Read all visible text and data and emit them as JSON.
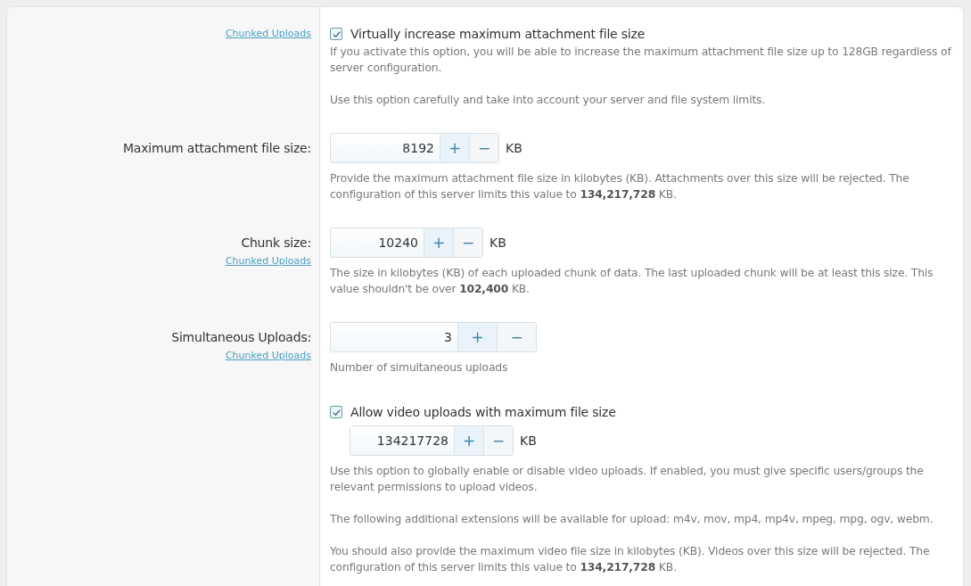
{
  "rows": [
    {
      "link": "Chunked Uploads",
      "checkbox": {
        "label": "Virtually increase maximum attachment file size",
        "checked": true
      },
      "paragraphs": [
        "If you activate this option, you will be able to increase the maximum attachment file size up to 128GB regardless of server configuration.",
        "Use this option carefully and take into account your server and file system limits."
      ]
    },
    {
      "label": "Maximum attachment file size:",
      "spinner": {
        "value": "8192",
        "increment": "+",
        "decrement": "−",
        "unit": "KB"
      },
      "paragraphs": [
        "Provide the maximum attachment file size in kilobytes (KB). Attachments over this size will be rejected. The configuration of this server limits this value to **134,217,728** KB."
      ]
    },
    {
      "label": "Chunk size:",
      "link": "Chunked Uploads",
      "spinner": {
        "value": "10240",
        "increment": "+",
        "decrement": "−",
        "unit": "KB"
      },
      "paragraphs": [
        "The size in kilobytes (KB) of each uploaded chunk of data. The last uploaded chunk will be at least this size. This value shouldn't be over **102,400** KB."
      ]
    },
    {
      "label": "Simultaneous Uploads:",
      "link": "Chunked Uploads",
      "spinner": {
        "value": "3",
        "increment": "+",
        "decrement": "−"
      },
      "paragraphs": [
        "Number of simultaneous uploads"
      ]
    },
    {
      "checkbox": {
        "label": "Allow video uploads with maximum file size",
        "checked": true
      },
      "spinner": {
        "value": "134217728",
        "increment": "+",
        "decrement": "−",
        "unit": "KB"
      },
      "paragraphs": [
        "Use this option to globally enable or disable video uploads. If enabled, you must give specific users/groups the relevant permissions to upload videos.",
        "The following additional extensions will be available for upload: m4v, mov, mp4, mp4v, mpeg, mpg, ogv, webm.",
        "You should also provide the maximum video file size in kilobytes (KB). Videos over this size will be rejected. The configuration of this server limits this value to **134,217,728** KB."
      ]
    }
  ]
}
